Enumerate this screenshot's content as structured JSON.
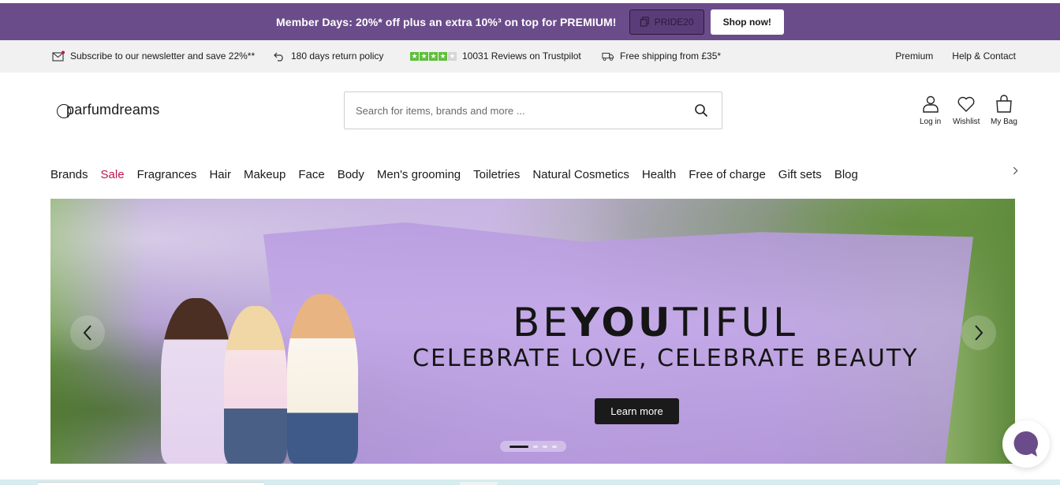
{
  "promo": {
    "text": "Member Days: 20%* off plus an extra 10%³ on top for PREMIUM!",
    "code": "PRIDE20",
    "shop_label": "Shop now!"
  },
  "usp": {
    "newsletter": "Subscribe to our newsletter and save 22%**",
    "returns": "180 days return policy",
    "reviews": "10031 Reviews on Trustpilot",
    "trustpilot_rating": 4,
    "shipping": "Free shipping from £35*",
    "premium": "Premium",
    "help": "Help & Contact"
  },
  "header": {
    "logo": "parfumdreams",
    "search_placeholder": "Search for items, brands and more ...",
    "login": "Log in",
    "wishlist": "Wishlist",
    "bag": "My Bag"
  },
  "nav": {
    "items": [
      "Brands",
      "Sale",
      "Fragrances",
      "Hair",
      "Makeup",
      "Face",
      "Body",
      "Men's grooming",
      "Toiletries",
      "Natural Cosmetics",
      "Health",
      "Free of charge",
      "Gift sets",
      "Blog"
    ],
    "more_icon": "chevron-right-icon"
  },
  "hero": {
    "title_pre": "BE",
    "title_bold": "YOU",
    "title_post": "TIFUL",
    "subtitle": "CELEBRATE LOVE, CELEBRATE BEAUTY",
    "cta": "Learn more",
    "slide_count": 4,
    "active_slide": 1
  },
  "colors": {
    "promo_bg": "#6b4c8a",
    "usp_bg": "#f1f1f1",
    "sale": "#c0144c",
    "trustpilot": "#5fbf3b",
    "chat": "#6b4c8a"
  }
}
